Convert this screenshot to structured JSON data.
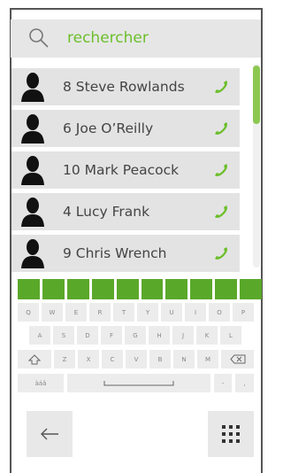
{
  "search": {
    "placeholder": "rechercher"
  },
  "contacts": [
    {
      "name": "8 Steve Rowlands"
    },
    {
      "name": "6  Joe O’Reilly"
    },
    {
      "name": "10 Mark Peacock"
    },
    {
      "name": "4  Lucy Frank"
    },
    {
      "name": "9  Chris Wrench"
    }
  ],
  "keyboard": {
    "row1": [
      "Q",
      "W",
      "E",
      "R",
      "T",
      "Y",
      "U",
      "I",
      "O",
      "P"
    ],
    "row2": [
      "A",
      "S",
      "D",
      "F",
      "G",
      "H",
      "J",
      "K",
      "L"
    ],
    "row3": [
      "Z",
      "X",
      "C",
      "V",
      "B",
      "N",
      "M"
    ],
    "row4": {
      "alt_label": "àáâ",
      "dash": "-",
      "comma": ","
    }
  },
  "colors": {
    "accent": "#6cbf2c",
    "green_key": "#5aa82a",
    "row_bg": "#e3e3e3"
  },
  "icons": {
    "search": "search-icon",
    "avatar": "person-silhouette-icon",
    "call": "phone-icon",
    "shift": "shift-icon",
    "backspace": "backspace-icon",
    "space": "spacebar-icon",
    "back": "back-arrow-icon",
    "dialpad": "dialpad-icon"
  }
}
